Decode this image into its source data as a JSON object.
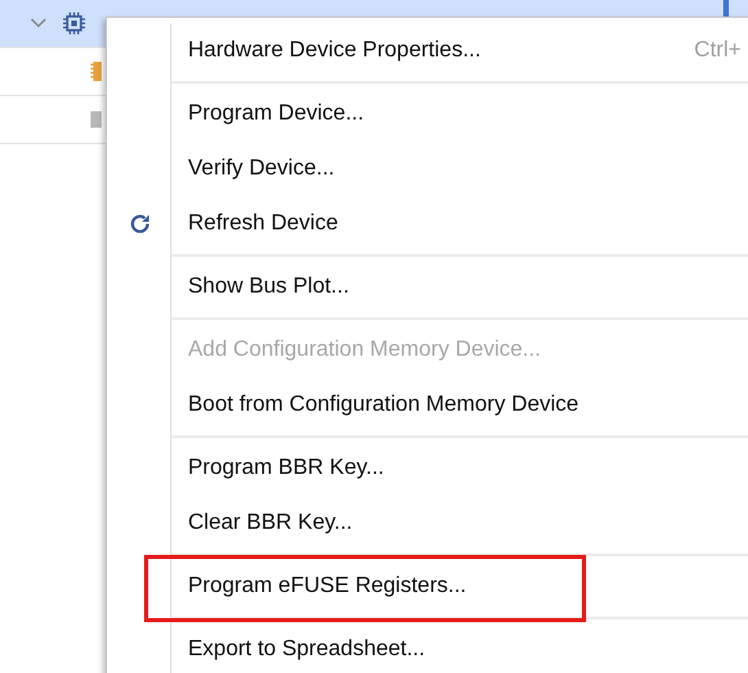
{
  "tree": {
    "rows": [
      {
        "kind": "device",
        "selected": true,
        "expanded": true
      },
      {
        "kind": "memory",
        "selected": false
      },
      {
        "kind": "sysmon",
        "selected": false
      }
    ]
  },
  "context_menu": {
    "items": [
      {
        "kind": "item",
        "label": "Hardware Device Properties...",
        "shortcut": "Ctrl+",
        "disabled": false
      },
      {
        "kind": "separator"
      },
      {
        "kind": "item",
        "label": "Program Device...",
        "disabled": false
      },
      {
        "kind": "item",
        "label": "Verify Device...",
        "disabled": false
      },
      {
        "kind": "icon_item",
        "label": "Refresh Device",
        "disabled": false
      },
      {
        "kind": "separator"
      },
      {
        "kind": "item",
        "label": "Show Bus Plot...",
        "disabled": false
      },
      {
        "kind": "separator"
      },
      {
        "kind": "item",
        "label": "Add Configuration Memory Device...",
        "disabled": true
      },
      {
        "kind": "item",
        "label": "Boot from Configuration Memory Device",
        "disabled": false
      },
      {
        "kind": "separator"
      },
      {
        "kind": "item",
        "label": "Program BBR Key...",
        "disabled": false
      },
      {
        "kind": "item",
        "label": "Clear BBR Key...",
        "disabled": false
      },
      {
        "kind": "separator"
      },
      {
        "kind": "item",
        "label": "Program eFUSE Registers...",
        "disabled": false,
        "annotated": true
      },
      {
        "kind": "separator"
      },
      {
        "kind": "item",
        "label": "Export to Spreadsheet...",
        "disabled": false
      }
    ]
  }
}
